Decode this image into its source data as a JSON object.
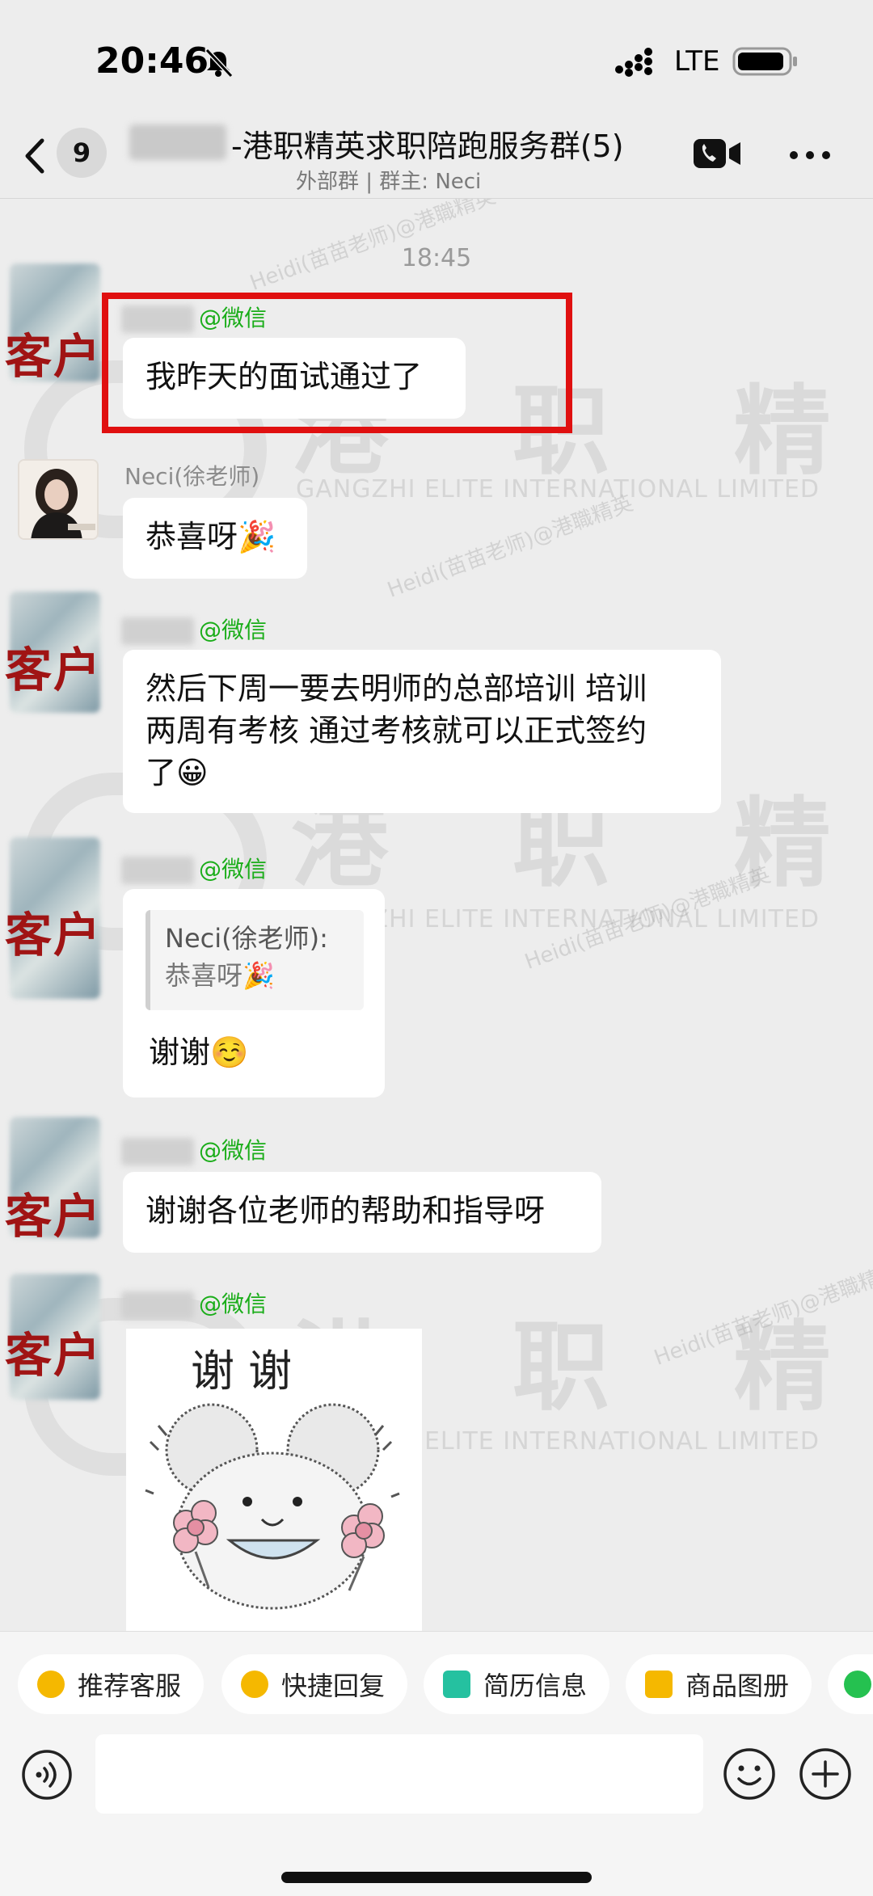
{
  "status_bar": {
    "time": "20:46",
    "network": "LTE"
  },
  "nav": {
    "unread_count": "9",
    "title": "-港职精英求职陪跑服务群(5)",
    "subtitle": "外部群 | 群主: Neci"
  },
  "watermark": {
    "brand_cn": "港 职 精 英",
    "brand_en": "GANGZHI ELITE INTERNATIONAL LIMITED",
    "tag": "Heidi(苗苗老师)@港職精英"
  },
  "chat": {
    "time_divider": "18:45",
    "client_label": "客户",
    "messages": [
      {
        "sender": "@微信",
        "text": "我昨天的面试通过了"
      },
      {
        "sender": "Neci(徐老师)",
        "text": "恭喜呀🎉"
      },
      {
        "sender": "@微信",
        "lines": [
          "然后下周一要去明师的总部培训 培训",
          "两周有考核 通过考核就可以正式签约",
          "了😀"
        ]
      },
      {
        "sender": "@微信",
        "quote_name": "Neci(徐老师):",
        "quote_text": "恭喜呀🎉",
        "text": "谢谢☺️"
      },
      {
        "sender": "@微信",
        "text": "谢谢各位老师的帮助和指导呀"
      },
      {
        "sender": "@微信",
        "sticker_text": "谢 谢"
      }
    ]
  },
  "quick_replies": [
    {
      "label": "推荐客服",
      "color": "#f5b800"
    },
    {
      "label": "快捷回复",
      "color": "#f5b800"
    },
    {
      "label": "简历信息",
      "color": "#25c1a0"
    },
    {
      "label": "商品图册",
      "color": "#f5b800"
    }
  ],
  "input": {
    "placeholder": ""
  },
  "icons": {
    "back": "chevron-left-icon",
    "mute": "bell-slash-icon",
    "video_call": "video-camera-icon",
    "more": "ellipsis-icon",
    "voice": "voice-icon",
    "emoji": "smiley-icon",
    "plus": "plus-icon"
  },
  "colors": {
    "background": "#ededed",
    "wechat_green": "#1aad19",
    "highlight_red": "#e01010",
    "client_label_red": "#a01414"
  }
}
